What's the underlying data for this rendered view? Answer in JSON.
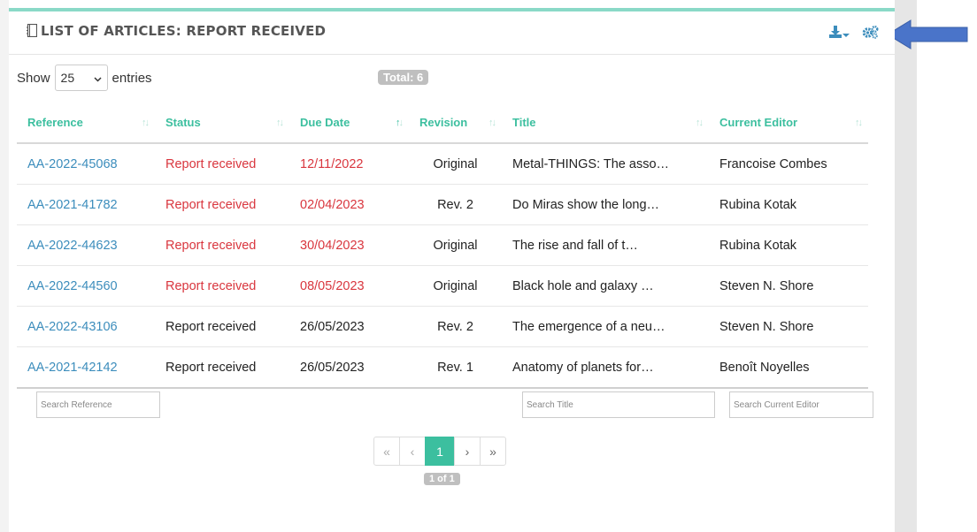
{
  "panel": {
    "title": "LIST OF ARTICLES: REPORT RECEIVED",
    "accent_color": "#8ad9c7",
    "tools": {
      "download_icon": "download-icon",
      "settings_icon": "gears-icon"
    },
    "annotation_arrow_color": "#4a74c9"
  },
  "length": {
    "prefix": "Show",
    "value": "25",
    "suffix": "entries"
  },
  "total_label": "Total: 6",
  "table": {
    "columns": [
      "Reference",
      "Status",
      "Due Date",
      "Revision",
      "Title",
      "Current Editor"
    ],
    "rows": [
      {
        "reference": "AA-2022-45068",
        "status": "Report received",
        "due": "12/11/2022",
        "revision": "Original",
        "title": "Metal-THINGS: The asso…",
        "editor": "Francoise Combes",
        "overdue": true
      },
      {
        "reference": "AA-2021-41782",
        "status": "Report received",
        "due": "02/04/2023",
        "revision": "Rev. 2",
        "title": "Do Miras show the long…",
        "editor": "Rubina Kotak",
        "overdue": true
      },
      {
        "reference": "AA-2022-44623",
        "status": "Report received",
        "due": "30/04/2023",
        "revision": "Original",
        "title": "The rise and fall of t…",
        "editor": "Rubina Kotak",
        "overdue": true
      },
      {
        "reference": "AA-2022-44560",
        "status": "Report received",
        "due": "08/05/2023",
        "revision": "Original",
        "title": "Black hole and galaxy …",
        "editor": "Steven N. Shore",
        "overdue": true
      },
      {
        "reference": "AA-2022-43106",
        "status": "Report received",
        "due": "26/05/2023",
        "revision": "Rev. 2",
        "title": "The emergence of a neu…",
        "editor": "Steven N. Shore",
        "overdue": false
      },
      {
        "reference": "AA-2021-42142",
        "status": "Report received",
        "due": "26/05/2023",
        "revision": "Rev. 1",
        "title": "Anatomy of planets for…",
        "editor": "Benoît Noyelles",
        "overdue": false
      }
    ]
  },
  "filters": {
    "reference_placeholder": "Search Reference",
    "title_placeholder": "Search Title",
    "editor_placeholder": "Search Current Editor"
  },
  "pagination": {
    "first": "«",
    "prev": "‹",
    "current": "1",
    "next": "›",
    "last": "»",
    "info": "1 of 1"
  }
}
